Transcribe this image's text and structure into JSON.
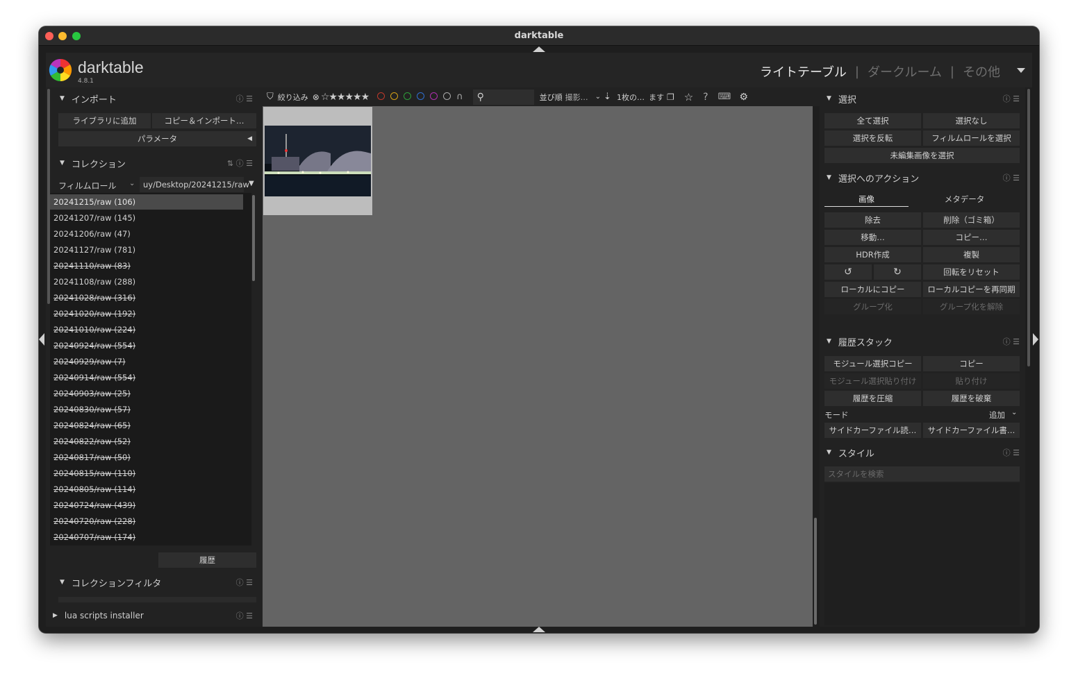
{
  "window": {
    "title": "darktable"
  },
  "app": {
    "name": "darktable",
    "version": "4.8.1"
  },
  "views": {
    "lighttable": "ライトテーブル",
    "darkroom": "ダークルーム",
    "other": "その他",
    "sep": "|"
  },
  "toolbar": {
    "filter": "絞り込み",
    "sort_label": "並び順",
    "sort_value": "撮影…",
    "view_label": "1枚の…",
    "view_suffix": "ます"
  },
  "import": {
    "title": "インポート",
    "add_library": "ライブラリに追加",
    "copy_import": "コピー＆インポート…",
    "params": "パラメータ"
  },
  "collection": {
    "title": "コレクション",
    "type": "フィルムロール",
    "path": "uy/Desktop/20241215/raw",
    "items": [
      {
        "label": "20241215/raw (106)",
        "selected": true,
        "missing": false
      },
      {
        "label": "20241207/raw (145)",
        "missing": false
      },
      {
        "label": "20241206/raw (47)",
        "missing": false
      },
      {
        "label": "20241127/raw (781)",
        "missing": false
      },
      {
        "label": "20241110/raw (83)",
        "missing": true
      },
      {
        "label": "20241108/raw (288)",
        "missing": false
      },
      {
        "label": "20241028/raw (316)",
        "missing": true
      },
      {
        "label": "20241020/raw (192)",
        "missing": true
      },
      {
        "label": "20241010/raw (224)",
        "missing": true
      },
      {
        "label": "20240924/raw (554)",
        "missing": true
      },
      {
        "label": "20240929/raw (7)",
        "missing": true
      },
      {
        "label": "20240914/raw (554)",
        "missing": true
      },
      {
        "label": "20240903/raw (25)",
        "missing": true
      },
      {
        "label": "20240830/raw (57)",
        "missing": true
      },
      {
        "label": "20240824/raw (65)",
        "missing": true
      },
      {
        "label": "20240822/raw (52)",
        "missing": true
      },
      {
        "label": "20240817/raw (50)",
        "missing": true
      },
      {
        "label": "20240815/raw (110)",
        "missing": true
      },
      {
        "label": "20240805/raw (114)",
        "missing": true
      },
      {
        "label": "20240724/raw (439)",
        "missing": true
      },
      {
        "label": "20240720/raw (228)",
        "missing": true
      },
      {
        "label": "20240707/raw (174)",
        "missing": true
      }
    ],
    "history": "履歴"
  },
  "collection_filter": {
    "title": "コレクションフィルタ"
  },
  "lua": {
    "title": "lua scripts installer"
  },
  "select": {
    "title": "選択",
    "all": "全て選択",
    "none": "選択なし",
    "invert": "選択を反転",
    "filmroll": "フィルムロールを選択",
    "untouched": "未編集画像を選択"
  },
  "actions": {
    "title": "選択へのアクション",
    "tab_images": "画像",
    "tab_metadata": "メタデータ",
    "remove": "除去",
    "delete": "削除（ゴミ箱）",
    "move": "移動…",
    "copy": "コピー…",
    "hdr": "HDR作成",
    "duplicate": "複製",
    "reset_rot": "回転をリセット",
    "copy_local": "ローカルにコピー",
    "resync_local": "ローカルコピーを再同期",
    "group": "グループ化",
    "ungroup": "グループ化を解除"
  },
  "history_stack": {
    "title": "履歴スタック",
    "sel_copy": "モジュール選択コピー",
    "copy": "コピー",
    "sel_paste": "モジュール選択貼り付け",
    "paste": "貼り付け",
    "compress": "履歴を圧縮",
    "discard": "履歴を破棄",
    "mode_label": "モード",
    "mode_value": "追加",
    "sidecar_load": "サイドカーファイル読…",
    "sidecar_write": "サイドカーファイル書…"
  },
  "styles": {
    "title": "スタイル",
    "search_placeholder": "スタイルを検索"
  },
  "colors": {
    "accent": "#e8e8e8",
    "disabled": "#6a6a6a",
    "red": "#c0392b",
    "yellow": "#d4a017",
    "green": "#2e9e3a",
    "blue": "#2f6fd0",
    "magenta": "#b02fb0"
  }
}
